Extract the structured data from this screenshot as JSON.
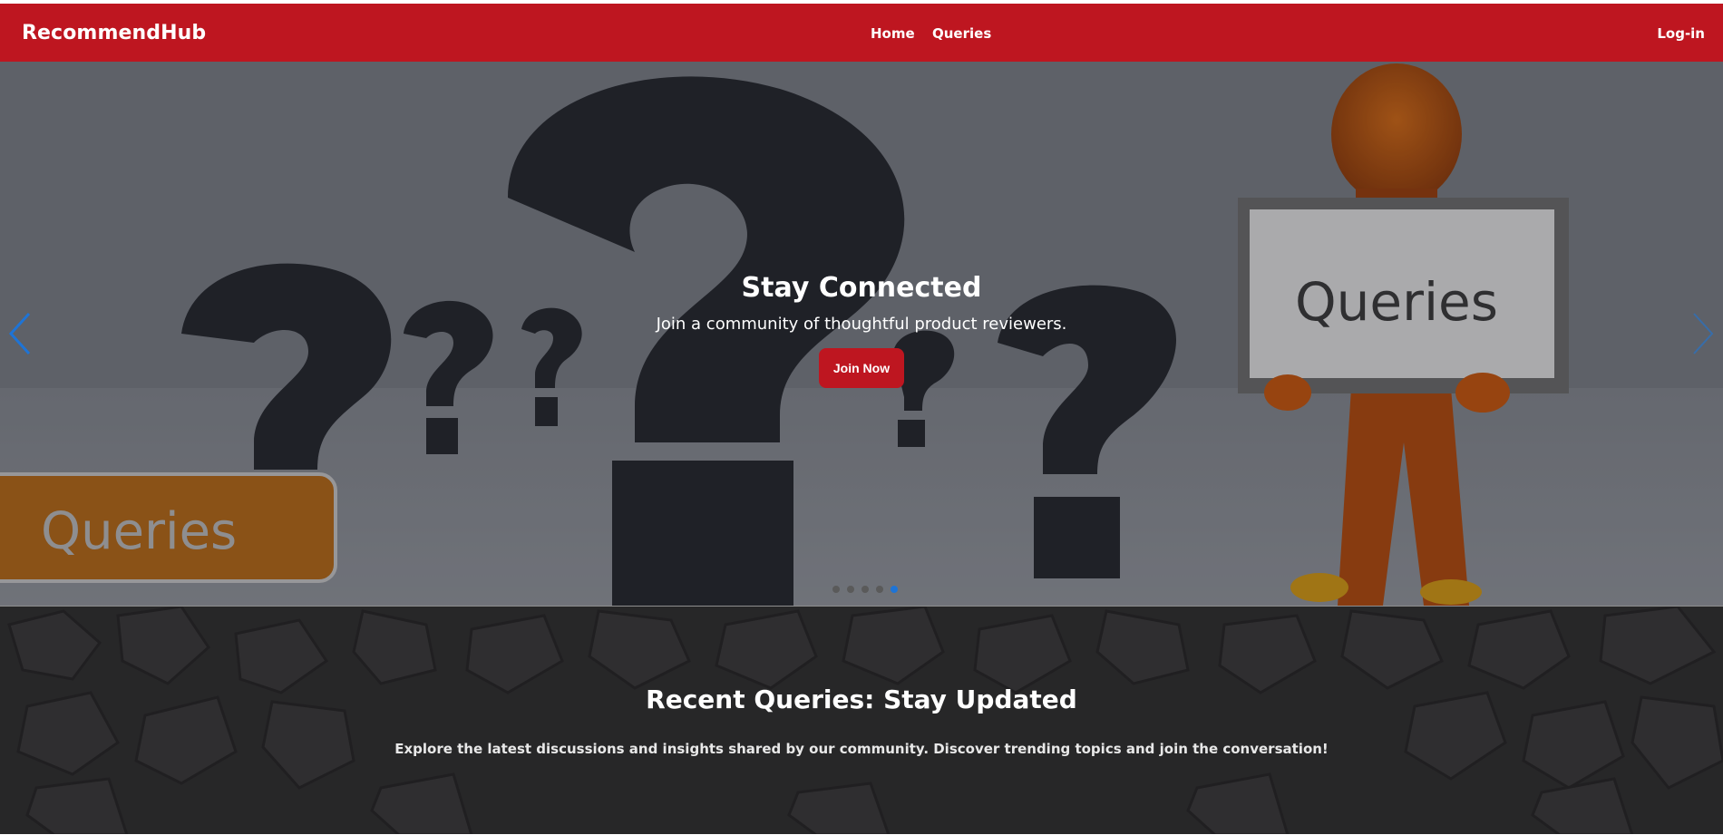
{
  "navbar": {
    "brand": "RecommendHub",
    "links": [
      "Home",
      "Queries"
    ],
    "login_label": "Log-in",
    "bg_color": "#be1620"
  },
  "hero": {
    "title": "Stay Connected",
    "subtitle": "Join a community of thoughtful product reviewers.",
    "cta_label": "Join Now",
    "image_sign_text": "Queries",
    "image_plaque_text": "Queries",
    "indicators_total": 5,
    "indicators_active": 5,
    "prev_arrow": "chevron-left-icon",
    "next_arrow": "chevron-right-icon"
  },
  "recent": {
    "title": "Recent Queries: Stay Updated",
    "subtitle": "Explore the latest discussions and insights shared by our community. Discover trending topics and join the conversation!"
  }
}
